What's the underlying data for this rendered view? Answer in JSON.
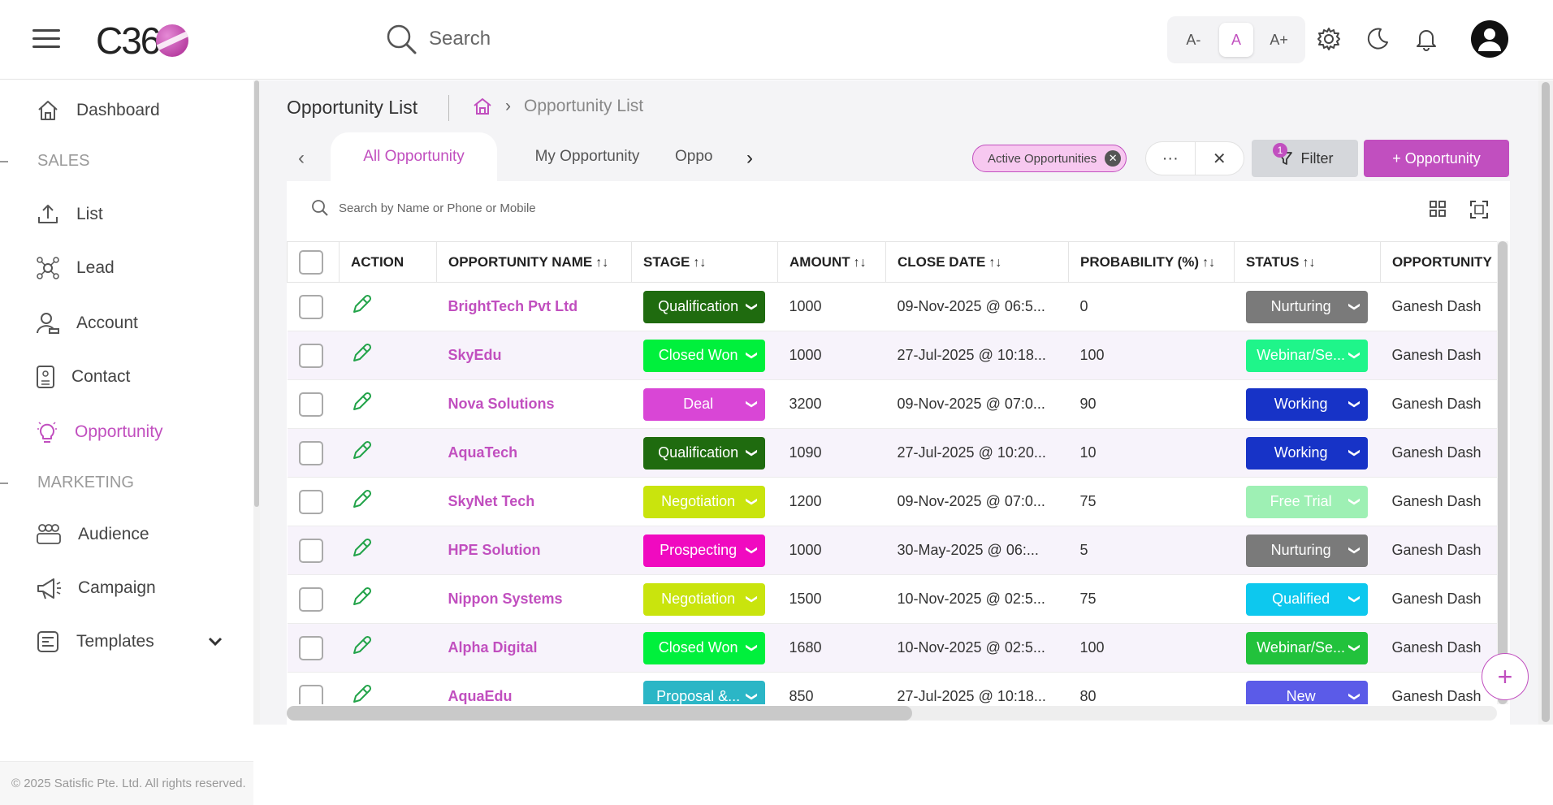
{
  "header": {
    "logo_text": "C36",
    "search_placeholder": "Search",
    "font_controls": [
      "A-",
      "A",
      "A+"
    ]
  },
  "sidebar": {
    "items": [
      {
        "label": "Dashboard",
        "icon": "home-icon"
      },
      {
        "label": "List",
        "icon": "upload-icon"
      },
      {
        "label": "Lead",
        "icon": "network-icon"
      },
      {
        "label": "Account",
        "icon": "user-icon"
      },
      {
        "label": "Contact",
        "icon": "contact-card-icon"
      },
      {
        "label": "Opportunity",
        "icon": "lightbulb-icon"
      },
      {
        "label": "Audience",
        "icon": "group-icon"
      },
      {
        "label": "Campaign",
        "icon": "megaphone-icon"
      },
      {
        "label": "Templates",
        "icon": "template-icon"
      }
    ],
    "sections": [
      "SALES",
      "MARKETING"
    ],
    "footer": "© 2025 Satisfic Pte. Ltd. All rights reserved."
  },
  "page": {
    "title": "Opportunity List",
    "breadcrumb_current": "Opportunity List"
  },
  "tabs": [
    "All Opportunity",
    "My Opportunity",
    "Oppo"
  ],
  "active_filter_chip": "Active Opportunities",
  "filter": {
    "label": "Filter",
    "count": "1"
  },
  "add_button": "+ Opportunity",
  "table_search_placeholder": "Search by Name or Phone or Mobile",
  "columns": [
    "ACTION",
    "OPPORTUNITY NAME",
    "STAGE",
    "AMOUNT",
    "CLOSE DATE",
    "PROBABILITY (%)",
    "STATUS",
    "OPPORTUNITY"
  ],
  "sort_glyph": "↑↓",
  "rows": [
    {
      "name": "BrightTech Pvt Ltd",
      "stage": "Qualification",
      "stage_color": "#1f6b0f",
      "amount": "1000",
      "close_date": "09-Nov-2025 @ 06:5...",
      "probability": "0",
      "status": "Nurturing",
      "status_color": "#7a7a7a",
      "owner": "Ganesh Dash"
    },
    {
      "name": "SkyEdu",
      "stage": "Closed Won",
      "stage_color": "#00f03c",
      "amount": "1000",
      "close_date": "27-Jul-2025 @ 10:18...",
      "probability": "100",
      "status": "Webinar/Se...",
      "status_color": "#1ff58a",
      "owner": "Ganesh Dash"
    },
    {
      "name": "Nova Solutions",
      "stage": "Deal",
      "stage_color": "#d946d6",
      "amount": "3200",
      "close_date": "09-Nov-2025 @ 07:0...",
      "probability": "90",
      "status": "Working",
      "status_color": "#1733c7",
      "owner": "Ganesh Dash"
    },
    {
      "name": "AquaTech",
      "stage": "Qualification",
      "stage_color": "#1f6b0f",
      "amount": "1090",
      "close_date": "27-Jul-2025 @ 10:20...",
      "probability": "10",
      "status": "Working",
      "status_color": "#1733c7",
      "owner": "Ganesh Dash"
    },
    {
      "name": "SkyNet Tech",
      "stage": "Negotiation",
      "stage_color": "#c9e40d",
      "amount": "1200",
      "close_date": "09-Nov-2025 @ 07:0...",
      "probability": "75",
      "status": "Free Trial",
      "status_color": "#9ef0b4",
      "owner": "Ganesh Dash"
    },
    {
      "name": "HPE Solution",
      "stage": "Prospecting",
      "stage_color": "#f00ac0",
      "amount": "1000",
      "close_date": "30-May-2025 @ 06:...",
      "probability": "5",
      "status": "Nurturing",
      "status_color": "#7a7a7a",
      "owner": "Ganesh Dash"
    },
    {
      "name": "Nippon Systems",
      "stage": "Negotiation",
      "stage_color": "#c9e40d",
      "amount": "1500",
      "close_date": "10-Nov-2025 @ 02:5...",
      "probability": "75",
      "status": "Qualified",
      "status_color": "#0dc8ee",
      "owner": "Ganesh Dash"
    },
    {
      "name": "Alpha Digital",
      "stage": "Closed Won",
      "stage_color": "#00f03c",
      "amount": "1680",
      "close_date": "10-Nov-2025 @ 02:5...",
      "probability": "100",
      "status": "Webinar/Se...",
      "status_color": "#22c23c",
      "owner": "Ganesh Dash"
    },
    {
      "name": "AquaEdu",
      "stage": "Proposal &...",
      "stage_color": "#2bb6c6",
      "amount": "850",
      "close_date": "27-Jul-2025 @ 10:18...",
      "probability": "80",
      "status": "New",
      "status_color": "#5b5be8",
      "owner": "Ganesh Dash"
    }
  ],
  "colors": {
    "accent": "#c14fbf"
  }
}
